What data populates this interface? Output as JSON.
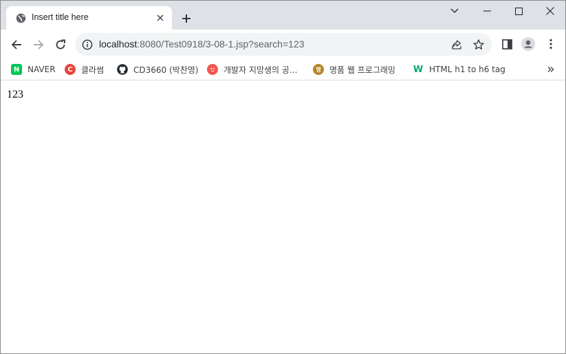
{
  "tab": {
    "title": "Insert title here",
    "favicon": "globe-icon"
  },
  "window_controls": [
    "tab-search-icon",
    "minimize-icon",
    "maximize-icon",
    "close-icon"
  ],
  "omnibox": {
    "host": "localhost",
    "rest": ":8080/Test0918/3-08-1.jsp?search=123"
  },
  "bookmarks": [
    {
      "label": "NAVER",
      "icon": "naver-icon",
      "icon_text": "N",
      "color": "#03c75a"
    },
    {
      "label": "클라썸",
      "icon": "classum-icon",
      "icon_text": "C",
      "color": "#e8453c"
    },
    {
      "label": "CD3660 (박찬영)",
      "icon": "github-icon",
      "icon_text": "",
      "color": "#24292f"
    },
    {
      "label": "개발자 지망생의 공...",
      "icon": "blog-icon",
      "icon_text": "",
      "color": "#f0584f"
    },
    {
      "label": "명품 웹 프로그래밍",
      "icon": "book-icon",
      "icon_text": "명",
      "color": "#b8862a"
    },
    {
      "label": "HTML h1 to h6 tag",
      "icon": "w3schools-icon",
      "icon_text": "W",
      "color": "#04aa6d"
    }
  ],
  "page": {
    "text": "123"
  }
}
